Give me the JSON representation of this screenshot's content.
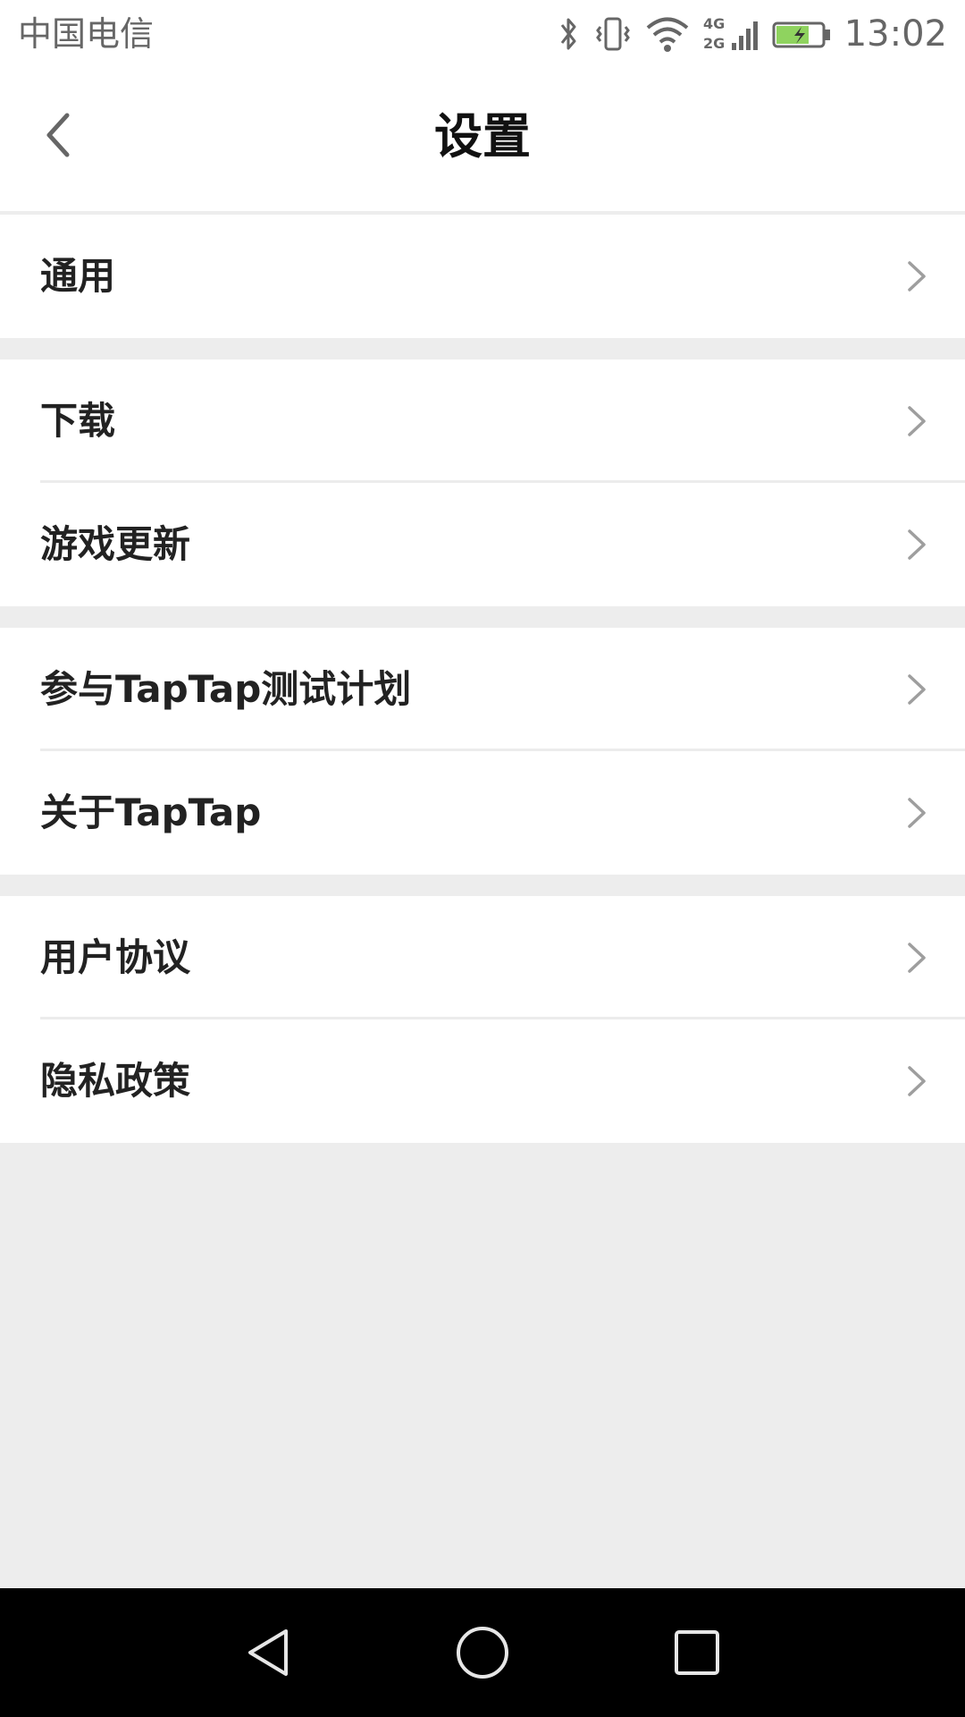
{
  "status_bar": {
    "carrier": "中国电信",
    "network_labels": [
      "4G",
      "2G"
    ],
    "time": "13:02",
    "icons": [
      "bluetooth-icon",
      "vibrate-icon",
      "wifi-icon",
      "cellular-signal-icon",
      "battery-charging-icon"
    ],
    "battery_color": "#8fd35f"
  },
  "header": {
    "title": "设置",
    "back_icon": "chevron-left-icon"
  },
  "groups": [
    {
      "items": [
        {
          "label": "通用"
        }
      ]
    },
    {
      "items": [
        {
          "label": "下载"
        },
        {
          "label": "游戏更新"
        }
      ]
    },
    {
      "items": [
        {
          "label": "参与TapTap测试计划"
        },
        {
          "label": "关于TapTap"
        }
      ]
    },
    {
      "items": [
        {
          "label": "用户协议"
        },
        {
          "label": "隐私政策"
        }
      ]
    }
  ],
  "nav_bar": {
    "buttons": [
      "back-triangle-icon",
      "home-circle-icon",
      "recents-square-icon"
    ]
  },
  "colors": {
    "background": "#ededed",
    "surface": "#ffffff",
    "text": "#222222",
    "chevron": "#9e9e9e",
    "nav_bar": "#000000"
  }
}
